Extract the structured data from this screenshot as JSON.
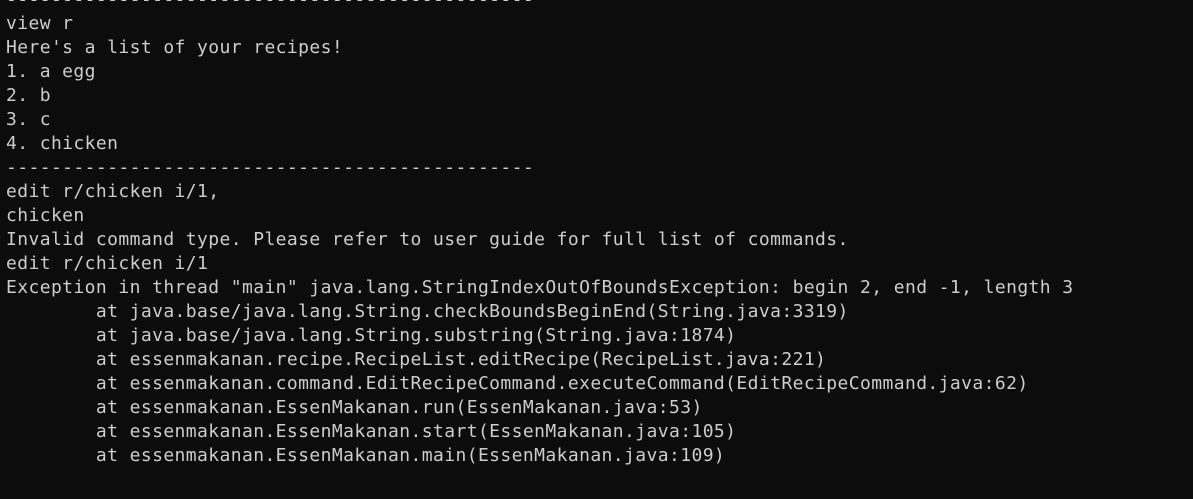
{
  "terminal": {
    "lines": [
      "-----------------------------------------------",
      "view r",
      "Here's a list of your recipes!",
      "1. a egg",
      "2. b",
      "3. c",
      "4. chicken",
      "-----------------------------------------------",
      "edit r/chicken i/1,",
      "chicken",
      "Invalid command type. Please refer to user guide for full list of commands.",
      "edit r/chicken i/1",
      "Exception in thread \"main\" java.lang.StringIndexOutOfBoundsException: begin 2, end -1, length 3",
      "        at java.base/java.lang.String.checkBoundsBeginEnd(String.java:3319)",
      "        at java.base/java.lang.String.substring(String.java:1874)",
      "        at essenmakanan.recipe.RecipeList.editRecipe(RecipeList.java:221)",
      "        at essenmakanan.command.EditRecipeCommand.executeCommand(EditRecipeCommand.java:62)",
      "        at essenmakanan.EssenMakanan.run(EssenMakanan.java:53)",
      "        at essenmakanan.EssenMakanan.start(EssenMakanan.java:105)",
      "        at essenmakanan.EssenMakanan.main(EssenMakanan.java:109)"
    ]
  },
  "colors": {
    "background": "#0c0c0c",
    "foreground": "#cccccc"
  }
}
